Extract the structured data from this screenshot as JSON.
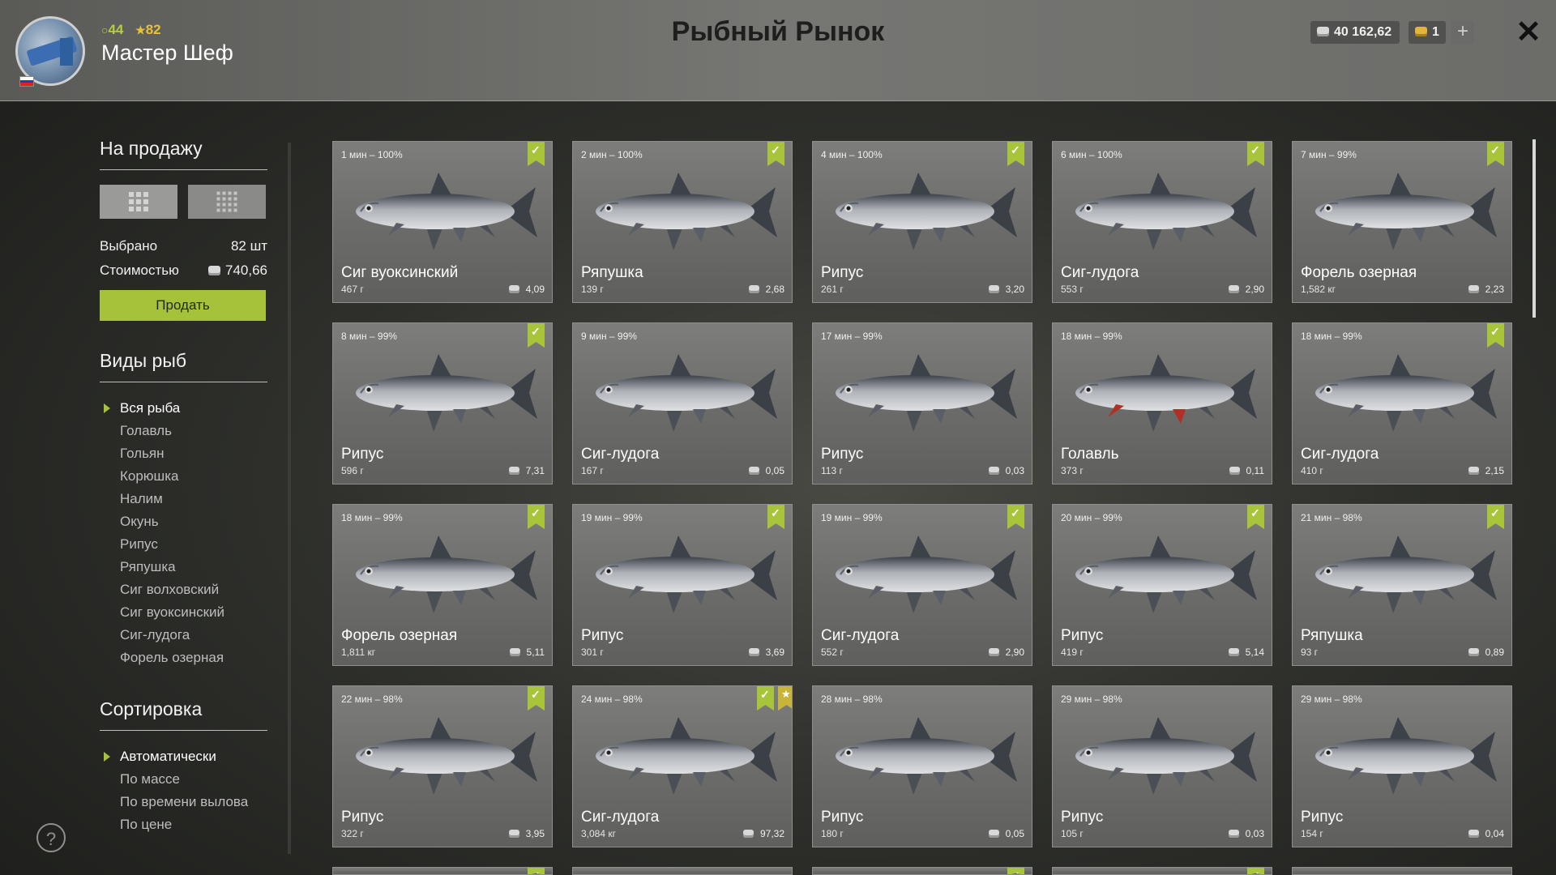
{
  "header": {
    "username": "Мастер Шеф",
    "level": "44",
    "rank": "82",
    "title": "Рыбный Рынок",
    "silver": "40 162,62",
    "gold": "1",
    "plus_label": "+",
    "close_label": "✕"
  },
  "sidebar": {
    "for_sale_title": "На продажу",
    "selected_label": "Выбрано",
    "selected_value": "82 шт",
    "cost_label": "Стоимостью",
    "cost_value": "740,66",
    "sell_button": "Продать",
    "fish_types_title": "Виды рыб",
    "fish_types": [
      "Вся рыба",
      "Голавль",
      "Гольян",
      "Корюшка",
      "Налим",
      "Окунь",
      "Рипус",
      "Ряпушка",
      "Сиг волховский",
      "Сиг вуоксинский",
      "Сиг-лудога",
      "Форель озерная"
    ],
    "sort_title": "Сортировка",
    "sort_options": [
      "Автоматически",
      "По массе",
      "По времени вылова",
      "По цене"
    ],
    "help_label": "?"
  },
  "cards": [
    {
      "time": "1 мин – 100%",
      "name": "Сиг вуоксинский",
      "weight": "467 г",
      "price": "4,09",
      "check": true,
      "star": false
    },
    {
      "time": "2 мин – 100%",
      "name": "Ряпушка",
      "weight": "139 г",
      "price": "2,68",
      "check": true,
      "star": false
    },
    {
      "time": "4 мин – 100%",
      "name": "Рипус",
      "weight": "261 г",
      "price": "3,20",
      "check": true,
      "star": false
    },
    {
      "time": "6 мин – 100%",
      "name": "Сиг-лудога",
      "weight": "553 г",
      "price": "2,90",
      "check": true,
      "star": false
    },
    {
      "time": "7 мин – 99%",
      "name": "Форель озерная",
      "weight": "1,582 кг",
      "price": "2,23",
      "check": true,
      "star": false
    },
    {
      "time": "8 мин – 99%",
      "name": "Рипус",
      "weight": "596 г",
      "price": "7,31",
      "check": true,
      "star": false
    },
    {
      "time": "9 мин – 99%",
      "name": "Сиг-лудога",
      "weight": "167 г",
      "price": "0,05",
      "check": false,
      "star": false
    },
    {
      "time": "17 мин – 99%",
      "name": "Рипус",
      "weight": "113 г",
      "price": "0,03",
      "check": false,
      "star": false
    },
    {
      "time": "18 мин – 99%",
      "name": "Голавль",
      "weight": "373 г",
      "price": "0,11",
      "check": false,
      "star": false
    },
    {
      "time": "18 мин – 99%",
      "name": "Сиг-лудога",
      "weight": "410 г",
      "price": "2,15",
      "check": true,
      "star": false
    },
    {
      "time": "18 мин – 99%",
      "name": "Форель озерная",
      "weight": "1,811 кг",
      "price": "5,11",
      "check": true,
      "star": false
    },
    {
      "time": "19 мин – 99%",
      "name": "Рипус",
      "weight": "301 г",
      "price": "3,69",
      "check": true,
      "star": false
    },
    {
      "time": "19 мин – 99%",
      "name": "Сиг-лудога",
      "weight": "552 г",
      "price": "2,90",
      "check": true,
      "star": false
    },
    {
      "time": "20 мин – 99%",
      "name": "Рипус",
      "weight": "419 г",
      "price": "5,14",
      "check": true,
      "star": false
    },
    {
      "time": "21 мин – 98%",
      "name": "Ряпушка",
      "weight": "93 г",
      "price": "0,89",
      "check": true,
      "star": false
    },
    {
      "time": "22 мин – 98%",
      "name": "Рипус",
      "weight": "322 г",
      "price": "3,95",
      "check": true,
      "star": false
    },
    {
      "time": "24 мин – 98%",
      "name": "Сиг-лудога",
      "weight": "3,084 кг",
      "price": "97,32",
      "check": true,
      "star": true
    },
    {
      "time": "28 мин – 98%",
      "name": "Рипус",
      "weight": "180 г",
      "price": "0,05",
      "check": false,
      "star": false
    },
    {
      "time": "29 мин – 98%",
      "name": "Рипус",
      "weight": "105 г",
      "price": "0,03",
      "check": false,
      "star": false
    },
    {
      "time": "29 мин – 98%",
      "name": "Рипус",
      "weight": "154 г",
      "price": "0,04",
      "check": false,
      "star": false
    }
  ],
  "partial_row_checks": [
    true,
    false,
    true,
    true,
    false
  ],
  "colors": {
    "accent": "#a6c23a",
    "level": "#b5cf3f",
    "rank": "#e6c13a"
  }
}
